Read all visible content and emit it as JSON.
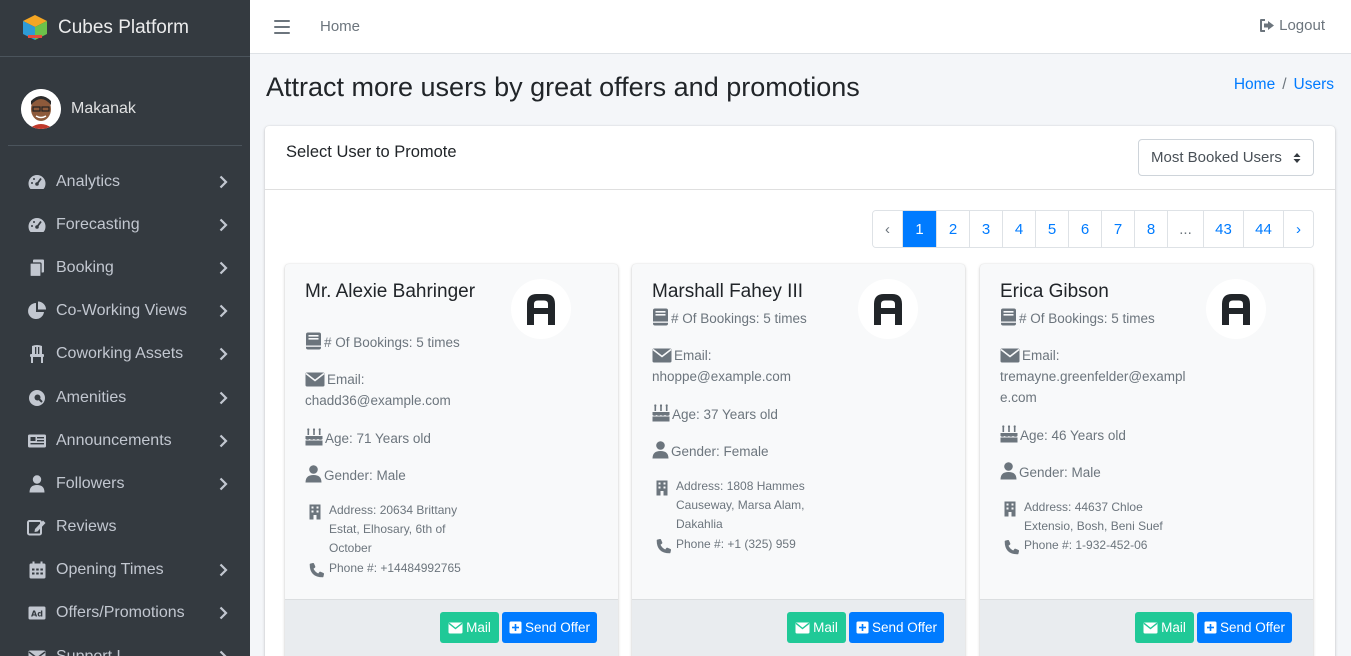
{
  "sidebar": {
    "brand": "Cubes Platform",
    "user": "Makanak",
    "items": [
      {
        "label": "Analytics",
        "icon": "gauge-icon",
        "chevron": true
      },
      {
        "label": "Forecasting",
        "icon": "gauge-icon",
        "chevron": true
      },
      {
        "label": "Booking",
        "icon": "copy-icon",
        "chevron": true
      },
      {
        "label": "Co-Working Views",
        "icon": "pie-chart-icon",
        "chevron": true
      },
      {
        "label": "Coworking Assets",
        "icon": "chair-icon",
        "chevron": true
      },
      {
        "label": "Amenities",
        "icon": "magnifier-icon",
        "chevron": true
      },
      {
        "label": "Announcements",
        "icon": "newspaper-icon",
        "chevron": true
      },
      {
        "label": "Followers",
        "icon": "user-icon",
        "chevron": true
      },
      {
        "label": "Reviews",
        "icon": "edit-icon",
        "chevron": false
      },
      {
        "label": "Opening Times",
        "icon": "calendar-icon",
        "chevron": true
      },
      {
        "label": "Offers/Promotions",
        "icon": "ad-icon",
        "chevron": true
      },
      {
        "label": "Support L",
        "icon": "envelope-icon",
        "chevron": true
      }
    ]
  },
  "topbar": {
    "home": "Home",
    "logout": "Logout"
  },
  "page": {
    "title": "Attract more users by great offers and promotions",
    "breadcrumb": [
      "Home",
      "Users"
    ],
    "breadcrumb_sep": "/"
  },
  "card": {
    "title": "Select User to Promote",
    "select_value": "Most Booked Users",
    "pagination": [
      "‹",
      "1",
      "2",
      "3",
      "4",
      "5",
      "6",
      "7",
      "8",
      "...",
      "43",
      "44",
      "›"
    ],
    "active_page": "1"
  },
  "users": [
    {
      "name": "Mr. Alexie Bahringer",
      "bookings": "# Of Bookings: 5 times",
      "email_label": "Email:",
      "email": "chadd36@example.com",
      "age": "Age: 71 Years old",
      "gender": "Gender: Male",
      "address": "Address: 20634 Brittany Estat, Elhosary, 6th of October",
      "phone": "Phone #: +14484992765"
    },
    {
      "name": "Marshall Fahey III",
      "bookings": "# Of Bookings: 5 times",
      "email_label": "Email:",
      "email": "nhoppe@example.com",
      "age": "Age: 37 Years old",
      "gender": "Gender: Female",
      "address": "Address: 1808 Hammes Causeway, Marsa Alam, Dakahlia",
      "phone": "Phone #: +1 (325) 959"
    },
    {
      "name": "Erica Gibson",
      "bookings": "# Of Bookings: 5 times",
      "email_label": "Email:",
      "email": "tremayne.greenfelder@example.com",
      "age": "Age: 46 Years old",
      "gender": "Gender: Male",
      "address": "Address: 44637 Chloe Extensio, Bosh, Beni Suef",
      "phone": "Phone #: 1-932-452-06"
    }
  ],
  "buttons": {
    "mail": "Mail",
    "send_offer": "Send Offer"
  },
  "colors": {
    "sidebar_bg": "#343a40",
    "accent": "#007bff",
    "mail_button": "#20c997"
  }
}
